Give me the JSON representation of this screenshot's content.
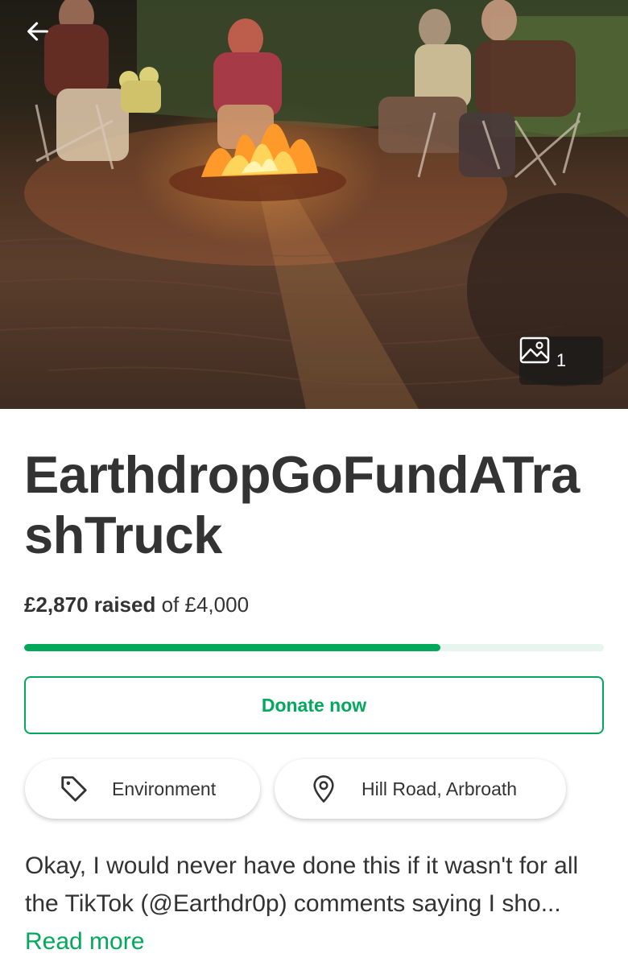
{
  "hero": {
    "photo_count": "1",
    "icons": {
      "back": "arrow-left-icon",
      "photos": "image-icon"
    }
  },
  "campaign": {
    "title": "EarthdropGoFundATrashTruck",
    "raised_amount": "£2,870 raised",
    "goal_text": "of £4,000",
    "progress_fraction": 0.7175,
    "donate_label": "Donate now",
    "category": "Environment",
    "location": "Hill Road, Arbroath",
    "story_excerpt": "Okay, I would never have done this if it wasn't for all the TikTok (@Earthdr0p) comments saying I sho...",
    "read_more_label": "Read more"
  },
  "colors": {
    "accent": "#02a95c",
    "progress_track": "#e6f6ef",
    "text": "#333333"
  }
}
